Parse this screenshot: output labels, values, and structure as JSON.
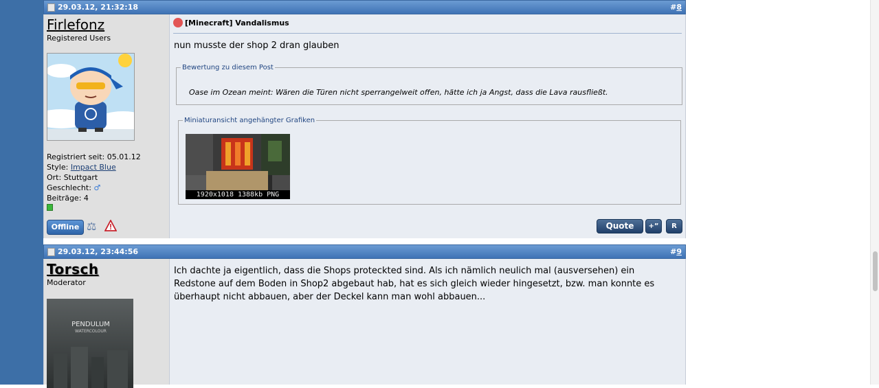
{
  "posts": [
    {
      "date": "29.03.12, 21:32:18",
      "number_prefix": "#",
      "number": "8",
      "username": "Firlefonz",
      "rank": "Registered Users",
      "registered": "Registriert seit: 05.01.12",
      "style_label": "Style:",
      "style_value": "Impact Blue",
      "location": "Ort: Stuttgart",
      "gender_label": "Geschlecht:",
      "gender_symbol": "♂",
      "posts_count": "Beiträge: 4",
      "status_button": "Offline",
      "title": "[Minecraft] Vandalismus",
      "text": "nun musste der shop 2 dran glauben",
      "rating_legend": "Bewertung zu diesem Post",
      "rating_text": "Oase im Ozean meint: Wären die Türen nicht sperrangelweit offen, hätte ich ja Angst, dass die Lava rausfließt.",
      "attachments_legend": "Miniaturansicht angehängter Grafiken",
      "attachment_caption": "1920x1018 1388kb PNG",
      "quote_button": "Quote",
      "multiquote_button": "+”",
      "report_button": "R"
    },
    {
      "date": "29.03.12, 23:44:56",
      "number_prefix": "#",
      "number": "9",
      "username": "Torsch",
      "rank": "Moderator",
      "avatar_text_1": "PENDULUM",
      "avatar_text_2": "WATERCOLOUR",
      "text": "Ich dachte ja eigentlich, dass die Shops proteckted sind. Als ich nämlich neulich mal (ausversehen) ein Redstone auf dem Boden in Shop2 abgebaut hab, hat es sich gleich wieder hingesetzt, bzw. man konnte es überhaupt nicht abbauen, aber der Deckel kann man wohl abbauen..."
    }
  ],
  "colors": {
    "header_blue": "#3f73b5",
    "side_blue": "#3d6fa7",
    "post_bg": "#e9edf3",
    "user_bg": "#e0e0e0",
    "button_dark": "#21406a"
  }
}
